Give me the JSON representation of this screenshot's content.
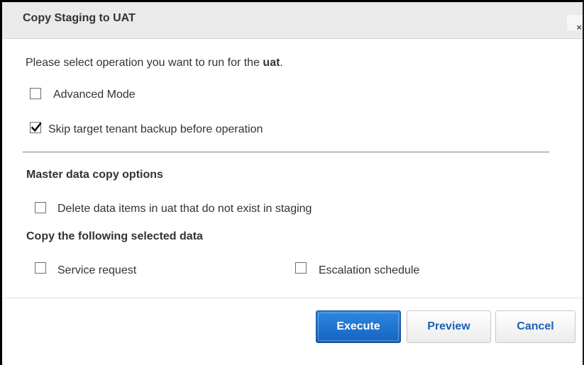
{
  "dialog": {
    "title": "Copy Staging to UAT",
    "close_glyph": "×"
  },
  "intro": {
    "prefix": "Please select operation you want to run for the ",
    "target": "uat",
    "suffix": "."
  },
  "options": {
    "advanced_mode": {
      "label": "Advanced Mode",
      "checked": false
    },
    "skip_backup": {
      "label": "Skip target tenant backup before operation",
      "checked": true
    }
  },
  "master_data": {
    "heading": "Master data copy options",
    "delete_items": {
      "label": "Delete data items in uat that do not exist in staging",
      "checked": false
    }
  },
  "copy_selected": {
    "heading": "Copy the following selected data",
    "service_request": {
      "label": "Service request",
      "checked": false
    },
    "escalation_schedule": {
      "label": "Escalation schedule",
      "checked": false
    }
  },
  "buttons": {
    "execute": "Execute",
    "preview": "Preview",
    "cancel": "Cancel"
  },
  "colors": {
    "accent": "#1a5fb4",
    "primary_button": "#1e73d2",
    "title_bar": "#eaeaea"
  }
}
